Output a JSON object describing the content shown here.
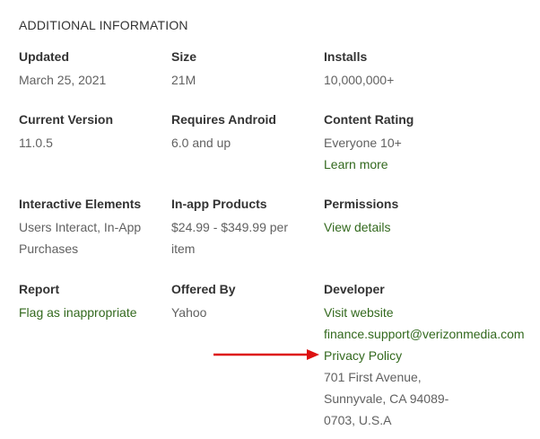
{
  "section_title": "ADDITIONAL INFORMATION",
  "rows": [
    [
      {
        "label": "Updated",
        "value": "March 25, 2021"
      },
      {
        "label": "Size",
        "value": "21M"
      },
      {
        "label": "Installs",
        "value": "10,000,000+"
      }
    ],
    [
      {
        "label": "Current Version",
        "value": "11.0.5"
      },
      {
        "label": "Requires Android",
        "value": "6.0 and up"
      },
      {
        "label": "Content Rating",
        "value": "Everyone 10+",
        "link": "Learn more"
      }
    ],
    [
      {
        "label": "Interactive Elements",
        "value": "Users Interact, In-App Purchases"
      },
      {
        "label": "In-app Products",
        "value": "$24.99 - $349.99 per item"
      },
      {
        "label": "Permissions",
        "link": "View details"
      }
    ],
    [
      {
        "label": "Report",
        "link": "Flag as inappropriate"
      },
      {
        "label": "Offered By",
        "value": "Yahoo"
      },
      {
        "label": "Developer",
        "links": [
          "Visit website",
          "finance.support@verizonmedia.com",
          "Privacy Policy"
        ],
        "address": "701 First Avenue, Sunnyvale, CA 94089-0703, U.S.A"
      }
    ]
  ],
  "colors": {
    "link": "#33691e",
    "label": "#333333",
    "value": "#616161",
    "annotation_arrow": "#dd1111"
  },
  "annotation": {
    "icon": "red-arrow-icon",
    "points_to": "Privacy Policy"
  }
}
